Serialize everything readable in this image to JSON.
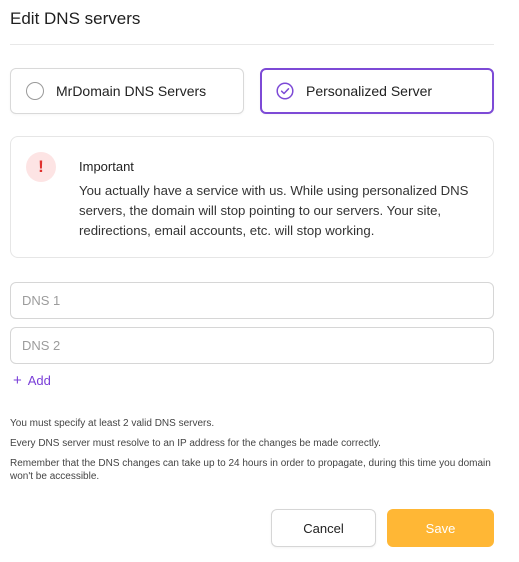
{
  "dialog": {
    "title": "Edit DNS servers"
  },
  "options": [
    {
      "label": "MrDomain DNS Servers",
      "selected": false
    },
    {
      "label": "Personalized Server",
      "selected": true
    }
  ],
  "notice": {
    "icon_glyph": "!",
    "icon_name": "exclamation-icon",
    "title": "Important",
    "body": "You actually have a service with us. While using personalized DNS servers, the domain will stop pointing to our servers. Your site, redirections, email accounts, etc. will stop working."
  },
  "dns_fields": [
    {
      "placeholder": "DNS 1",
      "value": ""
    },
    {
      "placeholder": "DNS 2",
      "value": ""
    }
  ],
  "add_link": {
    "icon": "+",
    "label": "Add"
  },
  "help_text": [
    "You must specify at least 2 valid DNS servers.",
    "Every DNS server must resolve to an IP address for the changes be made correctly.",
    "Remember that the DNS changes can take up to 24 hours in order to propagate, during this time you domain won't be accessible."
  ],
  "buttons": {
    "cancel_label": "Cancel",
    "save_label": "Save"
  },
  "colors": {
    "accent": "#7d4ad6",
    "save": "#ffb735",
    "warning": "#e0312f",
    "warning_bg": "#fde4e4"
  }
}
